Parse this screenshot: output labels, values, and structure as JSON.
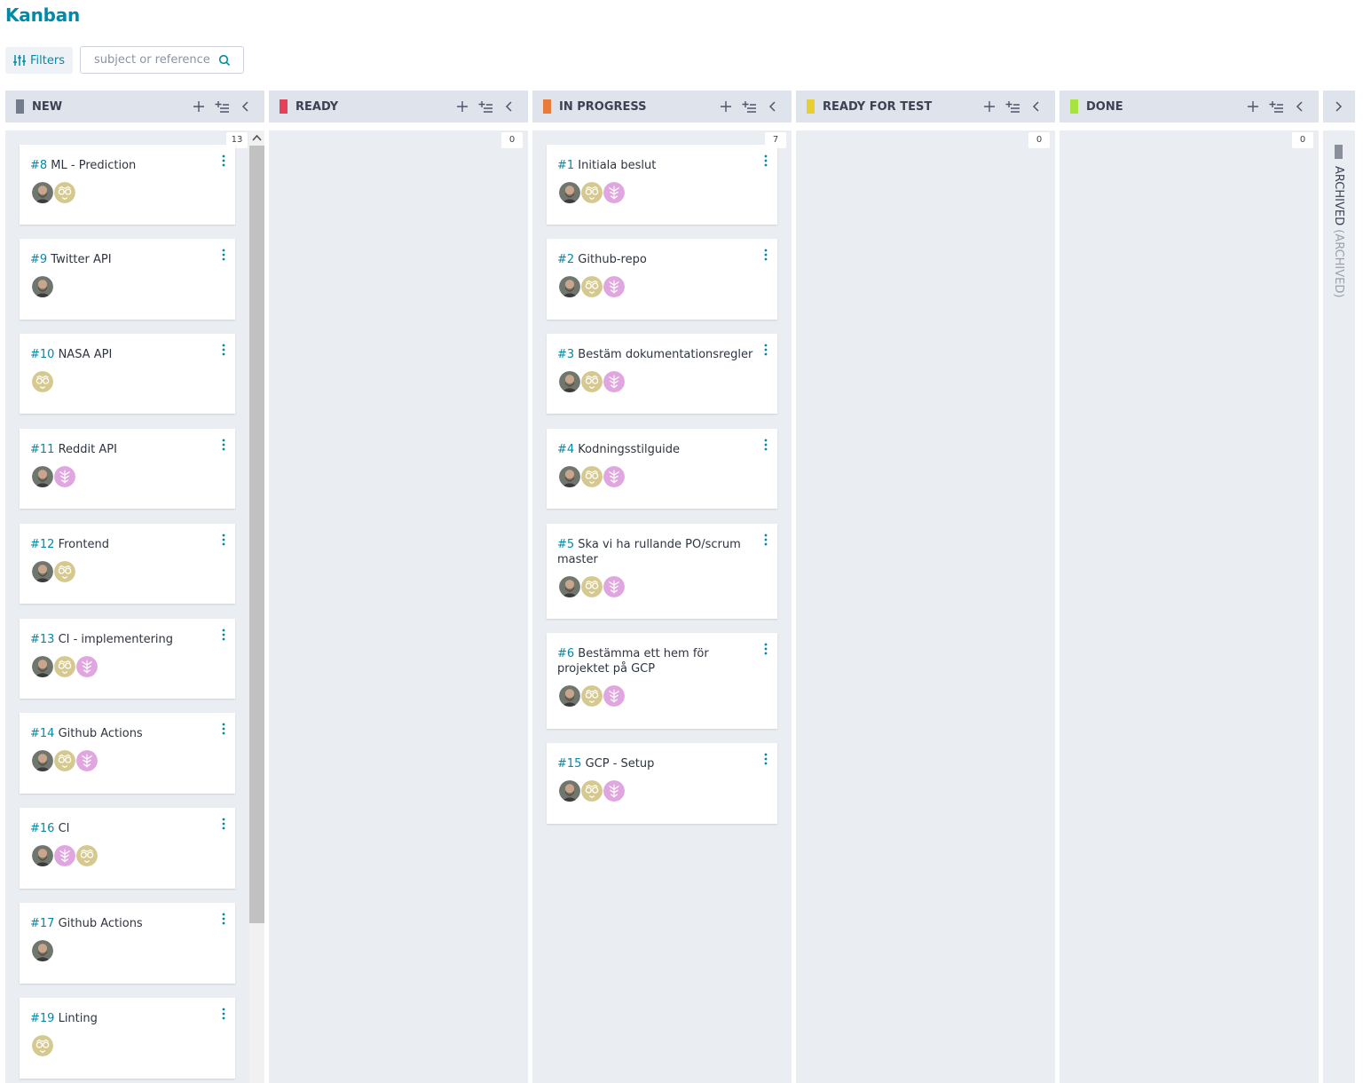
{
  "page": {
    "title": "Kanban"
  },
  "toolbar": {
    "filters_label": "Filters",
    "search_placeholder": "subject or reference"
  },
  "colors": {
    "accent": "#008aa8",
    "header_bg": "#dfe3ec",
    "column_bg": "#eaedf2"
  },
  "columns": [
    {
      "name": "NEW",
      "color": "#737b8c",
      "count": "13"
    },
    {
      "name": "READY",
      "color": "#e44057",
      "count": "0"
    },
    {
      "name": "IN PROGRESS",
      "color": "#e87a3c",
      "count": "7"
    },
    {
      "name": "READY FOR TEST",
      "color": "#e8cf31",
      "count": "0"
    },
    {
      "name": "DONE",
      "color": "#a8e440",
      "count": "0"
    }
  ],
  "archived": {
    "label": "ARCHIVED",
    "sub_label": "(ARCHIVED)"
  },
  "cards": {
    "new": [
      {
        "ref": "#8",
        "subject": " ML - Prediction",
        "avatars": [
          "photo",
          "tan"
        ]
      },
      {
        "ref": "#9",
        "subject": " Twitter API",
        "avatars": [
          "photo"
        ]
      },
      {
        "ref": "#10",
        "subject": " NASA API",
        "avatars": [
          "tan"
        ]
      },
      {
        "ref": "#11",
        "subject": " Reddit API",
        "avatars": [
          "photo",
          "pink"
        ]
      },
      {
        "ref": "#12",
        "subject": " Frontend",
        "avatars": [
          "photo",
          "tan"
        ]
      },
      {
        "ref": "#13",
        "subject": " CI - implementering",
        "avatars": [
          "photo",
          "tan",
          "pink"
        ]
      },
      {
        "ref": "#14",
        "subject": " Github Actions",
        "avatars": [
          "photo",
          "tan",
          "pink"
        ]
      },
      {
        "ref": "#16",
        "subject": " CI",
        "avatars": [
          "photo",
          "pink",
          "tan"
        ]
      },
      {
        "ref": "#17",
        "subject": " Github Actions",
        "avatars": [
          "photo"
        ]
      },
      {
        "ref": "#19",
        "subject": " Linting",
        "avatars": [
          "tan"
        ]
      }
    ],
    "in_progress": [
      {
        "ref": "#1",
        "subject": " Initiala beslut",
        "avatars": [
          "photo",
          "tan",
          "pink"
        ]
      },
      {
        "ref": "#2",
        "subject": " Github-repo",
        "avatars": [
          "photo",
          "tan",
          "pink"
        ]
      },
      {
        "ref": "#3",
        "subject": " Bestäm dokumentationsregler",
        "avatars": [
          "photo",
          "tan",
          "pink"
        ]
      },
      {
        "ref": "#4",
        "subject": " Kodningsstilguide",
        "avatars": [
          "photo",
          "tan",
          "pink"
        ]
      },
      {
        "ref": "#5",
        "subject": " Ska vi ha rullande PO/scrum master",
        "avatars": [
          "photo",
          "tan",
          "pink"
        ]
      },
      {
        "ref": "#6",
        "subject": " Bestämma ett hem för projektet på GCP",
        "avatars": [
          "photo",
          "tan",
          "pink"
        ]
      },
      {
        "ref": "#15",
        "subject": " GCP - Setup",
        "avatars": [
          "photo",
          "tan",
          "pink"
        ]
      }
    ]
  }
}
